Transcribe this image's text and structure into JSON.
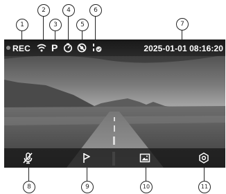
{
  "status_bar": {
    "rec_label": "REC",
    "mode_letter": "P",
    "datetime": "2025-01-01 08:16:20",
    "icons": [
      "record-dot-icon",
      "wifi-icon",
      "timer-icon",
      "motion-detection-off-icon",
      "microphone-battery-icon"
    ]
  },
  "bottom_bar": {
    "icons": [
      "microphone-off-icon",
      "flag-icon",
      "photo-icon",
      "settings-icon"
    ]
  },
  "callouts": {
    "c1": "1",
    "c2": "2",
    "c3": "3",
    "c4": "4",
    "c5": "5",
    "c6": "6",
    "c7": "7",
    "c8": "8",
    "c9": "9",
    "c10": "10",
    "c11": "11"
  },
  "colors": {
    "text": "#ffffff",
    "bar": "#1e1e1e",
    "callout_line": "#222222"
  }
}
